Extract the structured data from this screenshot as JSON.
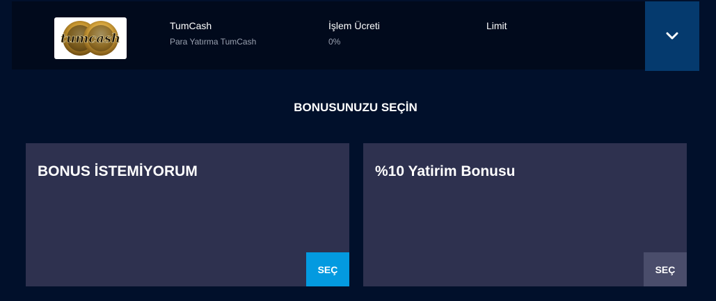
{
  "payment_method": {
    "logo_text": "tumcash",
    "name": "TumCash",
    "subtitle": "Para Yatırma TumCash",
    "fee_label": "İşlem Ücreti",
    "fee_value": "0%",
    "limit_label": "Limit",
    "expand_icon": "chevron-down-icon"
  },
  "bonus_section": {
    "title": "BONUSUNUZU SEÇİN",
    "options": [
      {
        "title": "BONUS İSTEMİYORUM",
        "button_label": "SEÇ",
        "state": "selected",
        "button_color": "#039ae0"
      },
      {
        "title": "%10 Yatirim Bonusu",
        "button_label": "SEÇ",
        "state": "unselected",
        "button_color": "#4a4d6b"
      }
    ]
  },
  "colors": {
    "background": "#01102b",
    "row_background": "#010a1c",
    "card_background": "#2e314f",
    "expand_button": "#053a6e",
    "accent": "#039ae0"
  }
}
